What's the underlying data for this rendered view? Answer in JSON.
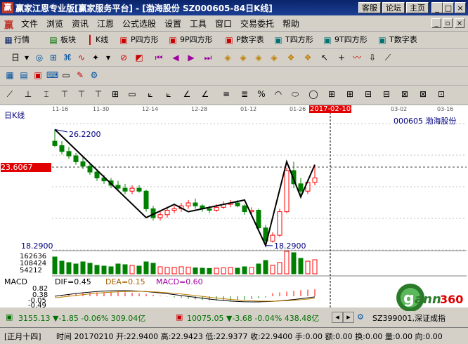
{
  "window": {
    "title": "赢家江恩专业版[赢家服务平台] - [渤海股份  SZ000605-84日K线]",
    "buttons": [
      "客服",
      "论坛",
      "主页"
    ]
  },
  "menu": [
    "文件",
    "浏览",
    "资讯",
    "江恩",
    "公式选股",
    "设置",
    "工具",
    "窗口",
    "交易委托",
    "帮助"
  ],
  "toolbar1": [
    "行情",
    "板块",
    "K线",
    "P四方形",
    "9P四方形",
    "P数字表",
    "T四方形",
    "9T四方形",
    "T数字表"
  ],
  "toolbar2": {
    "period": "日"
  },
  "chart": {
    "period_label": "日K线",
    "stock_label": "000605  渤海股份",
    "dates": [
      "11-16",
      "11-30",
      "12-14",
      "12-28",
      "01-12",
      "01-26",
      "2017-02-10",
      "03-02",
      "03-16"
    ],
    "price_marker": "23.6067",
    "high_label": "26.2200",
    "low_label": "18.2900",
    "axis_low": "18.2900",
    "volume_ticks": [
      "162636",
      "108424",
      "54212"
    ],
    "macd_title": "MACD",
    "macd_dif": "DIF=0.45",
    "macd_dea": "DEA=0.15",
    "macd_val": "MACD=0.60",
    "macd_ticks": [
      "0.82",
      "0.38",
      "-0.05",
      "-0.49"
    ],
    "colors": {
      "up": "#ff0000",
      "down": "#008000",
      "line": "#000000"
    }
  },
  "chart_data": {
    "type": "candlestick",
    "title": "",
    "candles": [
      {
        "o": 25.4,
        "h": 26.2,
        "l": 25.0,
        "c": 25.1
      },
      {
        "o": 25.1,
        "h": 25.4,
        "l": 24.5,
        "c": 24.7
      },
      {
        "o": 24.7,
        "h": 25.0,
        "l": 24.2,
        "c": 24.4
      },
      {
        "o": 24.4,
        "h": 24.6,
        "l": 23.8,
        "c": 24.0
      },
      {
        "o": 24.0,
        "h": 24.3,
        "l": 23.5,
        "c": 23.7
      },
      {
        "o": 23.7,
        "h": 23.9,
        "l": 23.1,
        "c": 23.3
      },
      {
        "o": 23.3,
        "h": 23.5,
        "l": 22.7,
        "c": 22.9
      },
      {
        "o": 22.9,
        "h": 23.1,
        "l": 22.5,
        "c": 22.7
      },
      {
        "o": 22.7,
        "h": 22.9,
        "l": 22.2,
        "c": 22.4
      },
      {
        "o": 22.4,
        "h": 22.7,
        "l": 22.0,
        "c": 22.2
      },
      {
        "o": 22.2,
        "h": 22.5,
        "l": 21.8,
        "c": 22.0
      },
      {
        "o": 22.0,
        "h": 22.4,
        "l": 21.8,
        "c": 22.2
      },
      {
        "o": 22.2,
        "h": 22.4,
        "l": 21.9,
        "c": 22.0
      },
      {
        "o": 22.0,
        "h": 22.1,
        "l": 20.6,
        "c": 20.8
      },
      {
        "o": 20.8,
        "h": 21.0,
        "l": 20.0,
        "c": 20.2
      },
      {
        "o": 20.2,
        "h": 20.6,
        "l": 20.0,
        "c": 20.4
      },
      {
        "o": 20.4,
        "h": 20.9,
        "l": 20.2,
        "c": 20.7
      },
      {
        "o": 20.7,
        "h": 21.0,
        "l": 20.5,
        "c": 20.8
      },
      {
        "o": 20.8,
        "h": 21.2,
        "l": 20.6,
        "c": 21.0
      },
      {
        "o": 21.0,
        "h": 21.4,
        "l": 20.8,
        "c": 21.2
      },
      {
        "o": 21.2,
        "h": 21.5,
        "l": 20.8,
        "c": 21.0
      },
      {
        "o": 21.0,
        "h": 21.1,
        "l": 20.6,
        "c": 20.8
      },
      {
        "o": 20.8,
        "h": 21.0,
        "l": 20.5,
        "c": 20.7
      },
      {
        "o": 20.7,
        "h": 21.1,
        "l": 20.6,
        "c": 20.9
      },
      {
        "o": 20.9,
        "h": 21.3,
        "l": 20.8,
        "c": 21.1
      },
      {
        "o": 21.1,
        "h": 21.4,
        "l": 20.9,
        "c": 21.2
      },
      {
        "o": 21.2,
        "h": 21.4,
        "l": 20.9,
        "c": 21.0
      },
      {
        "o": 21.0,
        "h": 21.1,
        "l": 20.4,
        "c": 20.6
      },
      {
        "o": 20.6,
        "h": 20.9,
        "l": 20.4,
        "c": 20.7
      },
      {
        "o": 20.7,
        "h": 20.8,
        "l": 19.3,
        "c": 19.5
      },
      {
        "o": 19.5,
        "h": 19.7,
        "l": 18.3,
        "c": 18.6
      },
      {
        "o": 18.6,
        "h": 19.2,
        "l": 18.5,
        "c": 19.0
      },
      {
        "o": 19.0,
        "h": 20.8,
        "l": 18.9,
        "c": 20.6
      },
      {
        "o": 20.6,
        "h": 23.6,
        "l": 20.5,
        "c": 23.4
      },
      {
        "o": 23.4,
        "h": 24.0,
        "l": 22.2,
        "c": 22.5
      },
      {
        "o": 22.5,
        "h": 22.9,
        "l": 21.6,
        "c": 22.0
      },
      {
        "o": 22.0,
        "h": 22.8,
        "l": 21.8,
        "c": 22.6
      },
      {
        "o": 22.6,
        "h": 23.8,
        "l": 22.4,
        "c": 22.9
      }
    ],
    "volume": [
      120,
      90,
      80,
      70,
      85,
      75,
      60,
      55,
      50,
      70,
      65,
      60,
      55,
      85,
      75,
      50,
      45,
      45,
      50,
      48,
      42,
      40,
      38,
      40,
      42,
      45,
      40,
      50,
      45,
      70,
      95,
      60,
      80,
      160,
      150,
      110,
      90,
      100
    ],
    "gann_line": [
      [
        0,
        26.2
      ],
      [
        13,
        20.2
      ],
      [
        17,
        21.1
      ],
      [
        19,
        20.6
      ],
      [
        27,
        21.4
      ],
      [
        30,
        18.3
      ],
      [
        33,
        24.0
      ],
      [
        35,
        21.6
      ],
      [
        37,
        23.8
      ]
    ],
    "ylim": [
      18.0,
      26.6
    ]
  },
  "status1": {
    "sh": "3155.13 ▼-1.85 -0.06% 309.04亿",
    "sz": "10075.05 ▼-3.68 -0.04% 438.48亿",
    "code": "SZ399001,深证成指"
  },
  "status2": {
    "date": "[正月十四]",
    "fields": "时间 20170210  开:22.9400  高:22.9423  低:22.9377  收:22.9400  手:0.00  额:0.00  换:0.00  量:0.00  向:0.00"
  }
}
